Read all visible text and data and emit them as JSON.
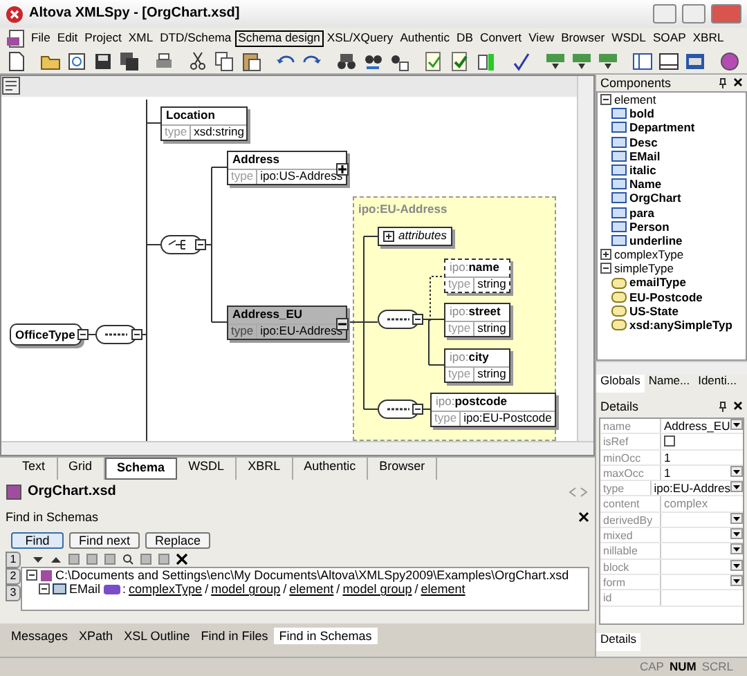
{
  "window": {
    "title": "Altova XMLSpy - [OrgChart.xsd]"
  },
  "menu": [
    {
      "label": "File",
      "selected": false
    },
    {
      "label": "Edit",
      "selected": false
    },
    {
      "label": "Project",
      "selected": false
    },
    {
      "label": "XML",
      "selected": false
    },
    {
      "label": "DTD/Schema",
      "selected": false
    },
    {
      "label": "Schema design",
      "selected": true
    },
    {
      "label": "XSL/XQuery",
      "selected": false
    },
    {
      "label": "Authentic",
      "selected": false
    },
    {
      "label": "DB",
      "selected": false
    },
    {
      "label": "Convert",
      "selected": false
    },
    {
      "label": "View",
      "selected": false
    },
    {
      "label": "Browser",
      "selected": false
    },
    {
      "label": "WSDL",
      "selected": false
    },
    {
      "label": "SOAP",
      "selected": false
    },
    {
      "label": "XBRL",
      "selected": false
    }
  ],
  "diagram": {
    "root": {
      "name": "OfficeType"
    },
    "elements": [
      {
        "name": "Location",
        "type_label": "type",
        "type": "xsd:string",
        "selected": false,
        "optional": false,
        "has_children": false
      },
      {
        "name": "Address",
        "type_label": "type",
        "type": "ipo:US-Address",
        "selected": false,
        "optional": false,
        "has_children": true,
        "expanded": false
      },
      {
        "name": "Address_EU",
        "type_label": "type",
        "type": "ipo:EU-Address",
        "selected": true,
        "optional": false,
        "has_children": true,
        "expanded": true
      },
      {
        "prefix": "ipo:",
        "name": "name",
        "type_label": "type",
        "type": "string",
        "selected": false,
        "optional": true,
        "has_children": false
      },
      {
        "prefix": "ipo:",
        "name": "street",
        "type_label": "type",
        "type": "string",
        "selected": false,
        "optional": false,
        "has_children": false
      },
      {
        "prefix": "ipo:",
        "name": "city",
        "type_label": "type",
        "type": "string",
        "selected": false,
        "optional": false,
        "has_children": false
      },
      {
        "prefix": "ipo:",
        "name": "postcode",
        "type_label": "type",
        "type": "ipo:EU-Postcode",
        "selected": false,
        "optional": false,
        "has_children": false
      }
    ],
    "group": {
      "title": "ipo:EU-Address",
      "attributes_label": "attributes"
    }
  },
  "view_tabs": [
    {
      "label": "Text",
      "selected": false
    },
    {
      "label": "Grid",
      "selected": false
    },
    {
      "label": "Schema",
      "selected": true
    },
    {
      "label": "WSDL",
      "selected": false
    },
    {
      "label": "XBRL",
      "selected": false
    },
    {
      "label": "Authentic",
      "selected": false
    },
    {
      "label": "Browser",
      "selected": false
    }
  ],
  "document_tab": {
    "title": "OrgChart.xsd"
  },
  "find_panel": {
    "title": "Find in Schemas",
    "buttons": [
      {
        "label": "Find",
        "selected": true
      },
      {
        "label": "Find next",
        "selected": false
      },
      {
        "label": "Replace",
        "selected": false
      }
    ],
    "side_tabs": [
      "1",
      "2",
      "3"
    ],
    "results": [
      {
        "text": "C:\\Documents and Settings\\enc\\My Documents\\Altova\\XMLSpy2009\\Examples\\OrgChart.xsd",
        "expanded": true,
        "children": [
          {
            "name": "EMail",
            "expanded": true,
            "lead": ":",
            "separator": "/",
            "path": [
              "complexType",
              "model group",
              "element",
              "model group",
              "element"
            ]
          }
        ]
      }
    ]
  },
  "output_tabs": [
    {
      "label": "Messages",
      "selected": false
    },
    {
      "label": "XPath",
      "selected": false
    },
    {
      "label": "XSL Outline",
      "selected": false
    },
    {
      "label": "Find in Files",
      "selected": false
    },
    {
      "label": "Find in Schemas",
      "selected": true
    }
  ],
  "components": {
    "title": "Components",
    "tree": [
      {
        "label": "element",
        "kind": "element",
        "expanded": true,
        "children": [
          {
            "label": "bold"
          },
          {
            "label": "Department"
          },
          {
            "label": "Desc"
          },
          {
            "label": "EMail"
          },
          {
            "label": "italic"
          },
          {
            "label": "Name"
          },
          {
            "label": "OrgChart"
          },
          {
            "label": "para"
          },
          {
            "label": "Person"
          },
          {
            "label": "underline"
          }
        ]
      },
      {
        "label": "complexType",
        "expanded": false
      },
      {
        "label": "simpleType",
        "kind": "simpleType",
        "expanded": true,
        "children": [
          {
            "label": "emailType"
          },
          {
            "label": "EU-Postcode"
          },
          {
            "label": "US-State"
          },
          {
            "label": "xsd:anySimpleTyp"
          }
        ]
      }
    ],
    "tabs": [
      {
        "label": "Globals",
        "selected": true
      },
      {
        "label": "Name...",
        "selected": false
      },
      {
        "label": "Identi...",
        "selected": false
      }
    ]
  },
  "details": {
    "title": "Details",
    "rows": [
      {
        "name": "name",
        "kind": "dropdown",
        "value": "Address_EU"
      },
      {
        "name": "isRef",
        "kind": "checkbox",
        "checked": false
      },
      {
        "name": "minOcc",
        "kind": "text",
        "value": "1"
      },
      {
        "name": "maxOcc",
        "kind": "dropdown",
        "value": "1"
      },
      {
        "name": "type",
        "kind": "dropdown",
        "value": "ipo:EU-Addres"
      },
      {
        "name": "content",
        "kind": "readonly",
        "value": "complex"
      },
      {
        "name": "derivedBy",
        "kind": "dropdown"
      },
      {
        "name": "mixed",
        "kind": "dropdown"
      },
      {
        "name": "nillable",
        "kind": "dropdown"
      },
      {
        "name": "block",
        "kind": "dropdown"
      },
      {
        "name": "form",
        "kind": "dropdown"
      },
      {
        "name": "id",
        "kind": "text"
      }
    ],
    "tabs": [
      {
        "label": "Details",
        "selected": true
      }
    ]
  },
  "status_bar": {
    "indicators": [
      {
        "label": "CAP",
        "on": false
      },
      {
        "label": "NUM",
        "on": true
      },
      {
        "label": "SCRL",
        "on": false
      }
    ]
  }
}
